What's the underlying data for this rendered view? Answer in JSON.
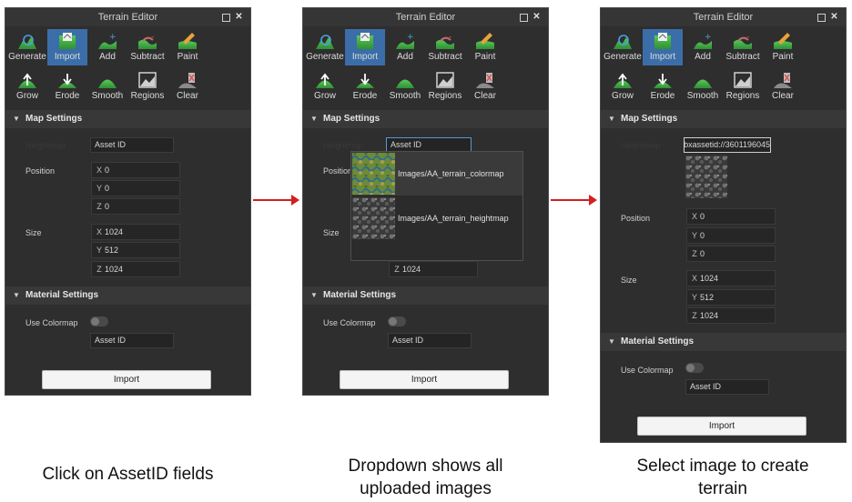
{
  "panel_title": "Terrain Editor",
  "tools": [
    {
      "label": "Generate",
      "icon": "generate-icon"
    },
    {
      "label": "Import",
      "icon": "import-icon"
    },
    {
      "label": "Add",
      "icon": "add-icon"
    },
    {
      "label": "Subtract",
      "icon": "subtract-icon"
    },
    {
      "label": "Paint",
      "icon": "paint-icon"
    },
    {
      "label": "Grow",
      "icon": "grow-icon"
    },
    {
      "label": "Erode",
      "icon": "erode-icon"
    },
    {
      "label": "Smooth",
      "icon": "smooth-icon"
    },
    {
      "label": "Regions",
      "icon": "regions-icon"
    },
    {
      "label": "Clear",
      "icon": "clear-icon"
    }
  ],
  "active_tool": "Import",
  "map_settings": {
    "header": "Map Settings",
    "heightmap_label": "Heightmap",
    "asset_placeholder": "Asset ID",
    "position_label": "Position",
    "position": {
      "x": "0",
      "y": "0",
      "z": "0"
    },
    "size_label": "Size",
    "size": {
      "x": "1024",
      "y": "512",
      "z": "1024"
    },
    "axis_labels": {
      "x": "X",
      "y": "Y",
      "z": "Z"
    }
  },
  "material_settings": {
    "header": "Material Settings",
    "use_colormap_label": "Use Colormap",
    "asset_placeholder": "Asset ID"
  },
  "import_button": "Import",
  "dropdown": {
    "items": [
      "Images/AA_terrain_colormap",
      "Images/AA_terrain_heightmap"
    ]
  },
  "panel3": {
    "asset_value": "rbxassetid://3601196045"
  },
  "captions": [
    "Click on AssetID fields",
    "Dropdown shows all uploaded images",
    "Select image to create terrain"
  ],
  "colors": {
    "panel_bg": "#2e2e2e",
    "active_tool": "#3b6ea8",
    "arrow": "#d21f1f",
    "focus_border": "#5a95d6"
  }
}
